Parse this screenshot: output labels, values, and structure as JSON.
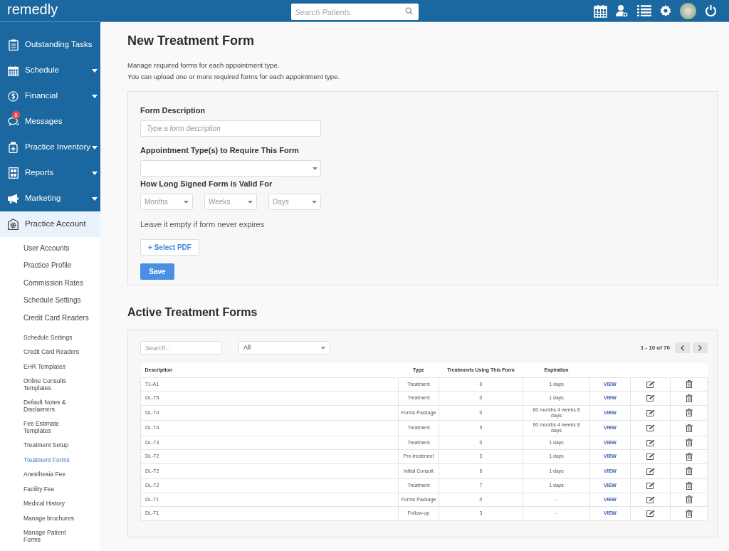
{
  "header": {
    "logo": "remedly",
    "search": {
      "placeholder": "Search Patients"
    }
  },
  "sidebar": {
    "items": [
      {
        "label": "Outstanding Tasks",
        "kind": "clipboard",
        "caret": false,
        "selected": false
      },
      {
        "label": "Schedule",
        "kind": "calendar",
        "caret": true,
        "selected": false
      },
      {
        "label": "Financial",
        "kind": "dollar",
        "caret": true,
        "selected": false
      },
      {
        "label": "Messages",
        "kind": "chat",
        "caret": false,
        "selected": false,
        "badge": "8"
      },
      {
        "label": "Practice Inventory",
        "kind": "bottle",
        "caret": true,
        "selected": false
      },
      {
        "label": "Reports",
        "kind": "report",
        "caret": true,
        "selected": false
      },
      {
        "label": "Marketing",
        "kind": "megaphone",
        "caret": true,
        "selected": false
      },
      {
        "label": "Practice Account",
        "kind": "gear-house",
        "caret": false,
        "selected": true
      }
    ],
    "sub_items": [
      {
        "label": "User Accounts",
        "selected": false
      },
      {
        "label": "Practice Profile",
        "selected": false
      },
      {
        "label": "Commission Rates",
        "selected": false
      },
      {
        "label": "Schedule Settings",
        "selected": false
      },
      {
        "label": "Credit Card Readers",
        "selected": false
      }
    ],
    "more_items": [
      {
        "label": "Schedule Settings",
        "selected": false
      },
      {
        "label": "Credit Card Readers",
        "selected": false
      },
      {
        "label": "EHR Templates",
        "selected": false
      },
      {
        "label": "Online Consults Templates",
        "selected": false
      },
      {
        "label": "Default Notes & Disclaimers",
        "selected": false
      },
      {
        "label": "Fee Estimate Templates",
        "selected": false
      },
      {
        "label": "Treatment Setup",
        "selected": false
      },
      {
        "label": "Treatment Forms",
        "selected": true
      },
      {
        "label": "Anesthesia Fee",
        "selected": false
      },
      {
        "label": "Facility Fee",
        "selected": false
      },
      {
        "label": "Medical History",
        "selected": false
      },
      {
        "label": "Manage brochures",
        "selected": false
      },
      {
        "label": "Manage Patient Forms",
        "selected": false
      }
    ]
  },
  "page": {
    "title": "New Treatment Form",
    "intro": [
      "Manage required forms for each appointment type.",
      "You can upload one or more required forms for each appointment type."
    ]
  },
  "form": {
    "description_label": "Form Description",
    "description_placeholder": "Type a form description",
    "appointment_label": "Appointment Type(s) to Require This Form",
    "valid_label": "How Long Signed Form is Valid For",
    "valid_selects": [
      "Months",
      "Weeks",
      "Days"
    ],
    "hint": "Leave it empty if form never expires",
    "select_pdf": "+ Select PDF",
    "save": "Save"
  },
  "active": {
    "title": "Active Treatment Forms",
    "search_placeholder": "Search...",
    "filter": "All",
    "pagination": "1 - 10 of 70",
    "columns": [
      "Description",
      "Type",
      "Treatments Using This Form",
      "Expiration"
    ],
    "rows": [
      {
        "description": "T1-A1",
        "type": "Treatment",
        "treatments": "0",
        "link": false,
        "expiration": "1 days",
        "action": "VIEW"
      },
      {
        "description": "DL-T5",
        "type": "Treatment",
        "treatments": "0",
        "link": false,
        "expiration": "1 days",
        "action": "VIEW"
      },
      {
        "description": "DL-T4",
        "type": "Forms Package",
        "treatments": "0",
        "link": false,
        "expiration": "60 months 4 weeks 8 days",
        "action": "VIEW"
      },
      {
        "description": "DL-T4",
        "type": "Treatment",
        "treatments": "5",
        "link": true,
        "expiration": "60 months 4 weeks 8 days",
        "action": "VIEW"
      },
      {
        "description": "DL-T3",
        "type": "Treatment",
        "treatments": "0",
        "link": false,
        "expiration": "1 days",
        "action": "VIEW"
      },
      {
        "description": "DL-T2",
        "type": "Pre-treatment",
        "treatments": "3",
        "link": true,
        "expiration": "1 days",
        "action": "VIEW"
      },
      {
        "description": "DL-T2",
        "type": "Initial Consult",
        "treatments": "6",
        "link": true,
        "expiration": "1 days",
        "action": "VIEW"
      },
      {
        "description": "DL-T2",
        "type": "Treatment",
        "treatments": "7",
        "link": true,
        "expiration": "1 days",
        "action": "VIEW"
      },
      {
        "description": "DL-T1",
        "type": "Forms Package",
        "treatments": "0",
        "link": false,
        "expiration": "-",
        "action": "VIEW"
      },
      {
        "description": "DL-T1",
        "type": "Follow-up",
        "treatments": "3",
        "link": true,
        "expiration": "-",
        "action": "VIEW"
      }
    ]
  }
}
